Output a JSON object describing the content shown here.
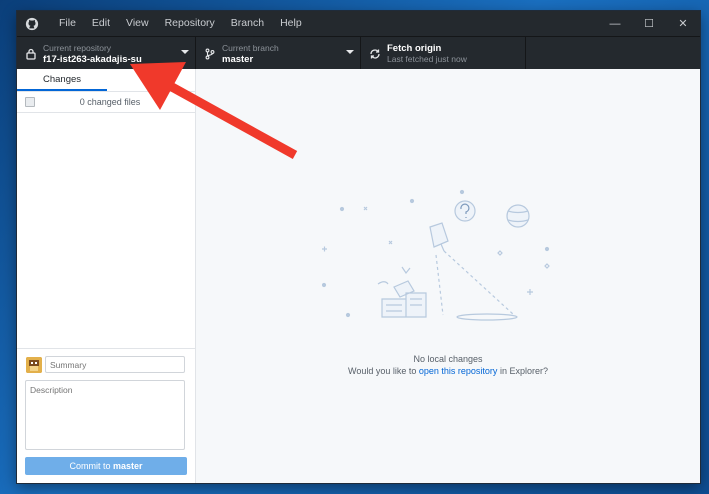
{
  "app": {
    "menu": [
      "File",
      "Edit",
      "View",
      "Repository",
      "Branch",
      "Help"
    ]
  },
  "window_controls": {
    "minimize": "—",
    "maximize": "☐",
    "close": "✕"
  },
  "toolbar": {
    "repository": {
      "caption": "Current repository",
      "value": "f17-ist263-akadajis-su"
    },
    "branch": {
      "caption": "Current branch",
      "value": "master"
    },
    "fetch": {
      "caption": "Fetch origin",
      "status": "Last fetched just now"
    }
  },
  "sidebar": {
    "tab_label": "Changes",
    "changed_files": "0 changed files",
    "summary_placeholder": "Summary",
    "description_placeholder": "Description",
    "commit_prefix": "Commit to ",
    "commit_branch": "master"
  },
  "main": {
    "empty_title": "No local changes",
    "empty_prefix": "Would you like to ",
    "empty_link": "open this repository",
    "empty_suffix": " in Explorer?"
  },
  "colors": {
    "accent": "#0366d6",
    "annotation_arrow": "#f0392b",
    "toolbar_bg": "#24292e"
  }
}
